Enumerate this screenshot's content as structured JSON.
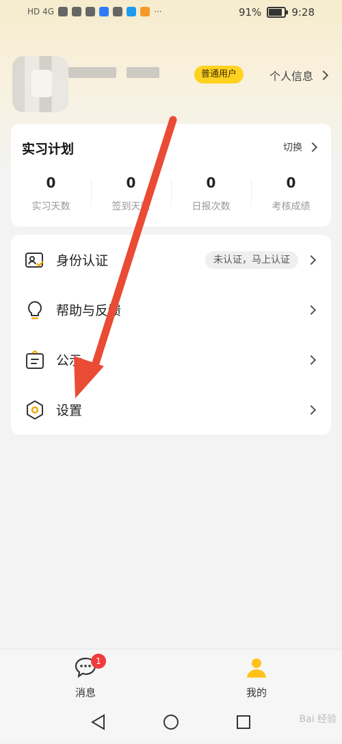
{
  "status_bar": {
    "left_text": "HD 4G",
    "more": "···",
    "battery_pct": "91%",
    "battery_level": 0.91,
    "time": "9:28"
  },
  "profile": {
    "badge": "普通用户",
    "info_link": "个人信息"
  },
  "plan": {
    "title": "实习计划",
    "switch_label": "切换",
    "stats": [
      {
        "value": "0",
        "label": "实习天数"
      },
      {
        "value": "0",
        "label": "签到天数"
      },
      {
        "value": "0",
        "label": "日报次数"
      },
      {
        "value": "0",
        "label": "考核成绩"
      }
    ]
  },
  "menu": {
    "items": [
      {
        "label": "身份认证",
        "tag": "未认证，马上认证",
        "icon": "id-card-icon"
      },
      {
        "label": "帮助与反馈",
        "icon": "lightbulb-icon"
      },
      {
        "label": "公示",
        "icon": "notice-board-icon"
      },
      {
        "label": "设置",
        "icon": "settings-hexagon-icon"
      }
    ]
  },
  "bottom_nav": {
    "messages_label": "消息",
    "messages_badge": "1",
    "me_label": "我的"
  },
  "colors": {
    "accent": "#ffd21f",
    "arrow": "#e94b34",
    "badge": "#f23b3b"
  },
  "watermark": "Bai 经验"
}
